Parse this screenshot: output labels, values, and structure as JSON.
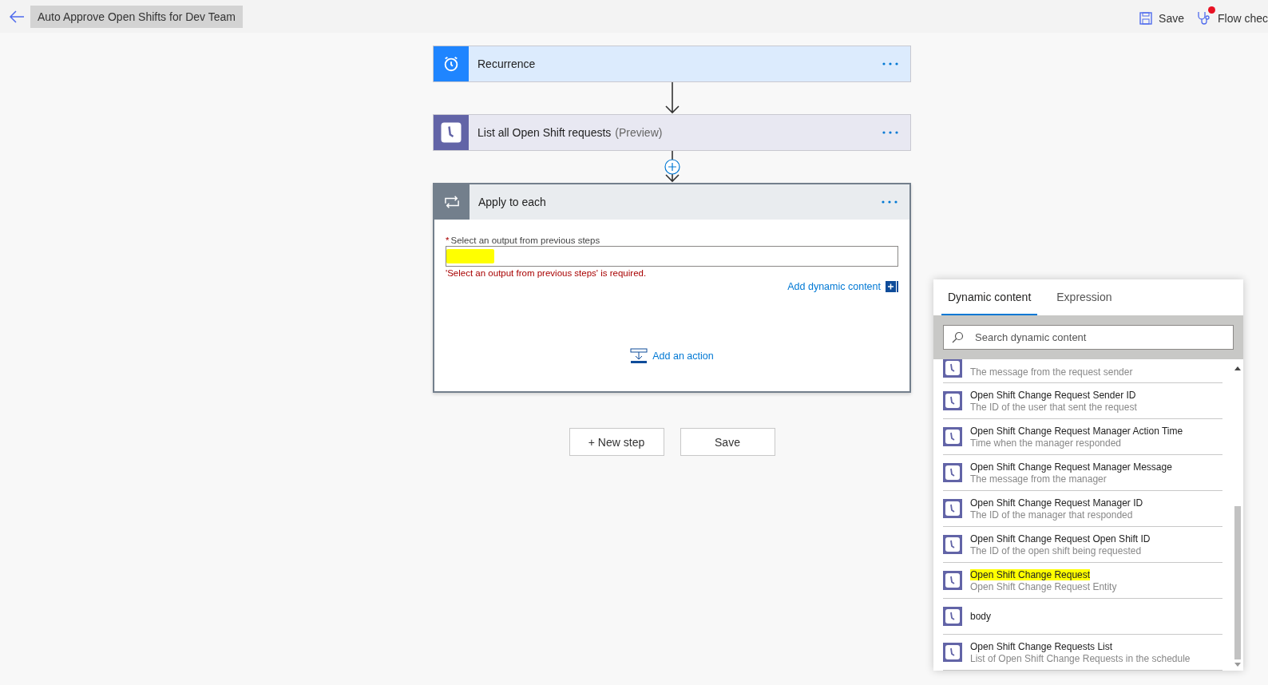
{
  "header": {
    "title": "Auto Approve Open Shifts for Dev Team",
    "actions": [
      {
        "kind": "save",
        "label": "Save",
        "alert": false
      },
      {
        "kind": "checker",
        "label": "Flow chec",
        "alert": true
      }
    ]
  },
  "steps": [
    {
      "kind": "trigger",
      "title": "Recurrence",
      "color": "#1f85ff"
    },
    {
      "kind": "action",
      "title": "List all Open Shift requests",
      "suffix": "(Preview)",
      "color": "#6264a7"
    },
    {
      "kind": "loop",
      "title": "Apply to each",
      "color": "#737f8c",
      "field": {
        "label": "Select an output from previous steps",
        "required_mark": "*",
        "highlighted": true,
        "error": "'Select an output from previous steps' is required.",
        "link": "Add dynamic content"
      },
      "add_action": "Add an action"
    }
  ],
  "buttons": [
    "+ New step",
    "Save"
  ],
  "panel": {
    "tabs": [
      {
        "label": "Dynamic content",
        "selected": true
      },
      {
        "label": "Expression",
        "selected": false
      }
    ],
    "search": {
      "placeholder": "Search dynamic content"
    },
    "items": [
      {
        "description": "The message from the request sender",
        "highlighted": false
      },
      {
        "title": "Open Shift Change Request Sender ID",
        "description": "The ID of the user that sent the request",
        "highlighted": false
      },
      {
        "title": "Open Shift Change Request Manager Action Time",
        "description": "Time when the manager responded",
        "highlighted": false
      },
      {
        "title": "Open Shift Change Request Manager Message",
        "description": "The message from the manager",
        "highlighted": false
      },
      {
        "title": "Open Shift Change Request Manager ID",
        "description": "The ID of the manager that responded",
        "highlighted": false
      },
      {
        "title": "Open Shift Change Request Open Shift ID",
        "description": "The ID of the open shift being requested",
        "highlighted": false
      },
      {
        "title": "Open Shift Change Request",
        "description": "Open Shift Change Request Entity",
        "highlighted": true
      },
      {
        "title": "body",
        "highlighted": false
      },
      {
        "title": "Open Shift Change Requests List",
        "description": "List of Open Shift Change Requests in the schedule",
        "highlighted": false
      }
    ]
  }
}
